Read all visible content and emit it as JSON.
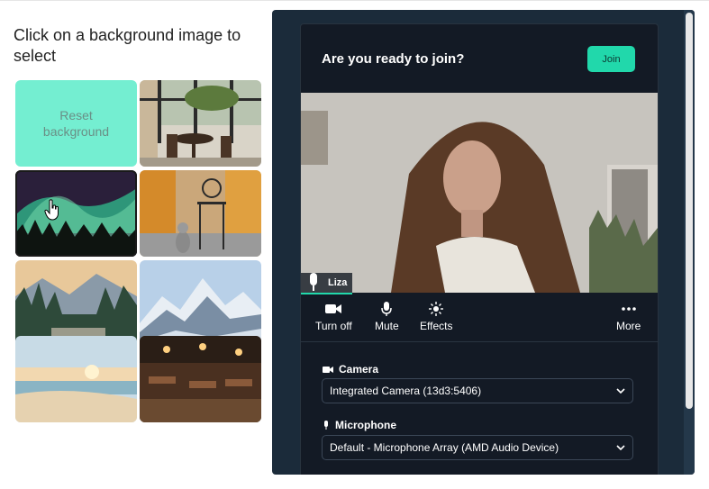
{
  "left_panel": {
    "instruction": "Click on a background image to select",
    "reset_label": "Reset background",
    "backgrounds": [
      {
        "name": "restaurant-terrace"
      },
      {
        "name": "aurora-forest"
      },
      {
        "name": "cafe-table-cat"
      },
      {
        "name": "mountain-forest"
      },
      {
        "name": "snowy-mountains"
      },
      {
        "name": "beach-sunset"
      },
      {
        "name": "restaurant-interior"
      }
    ]
  },
  "join_card": {
    "title": "Are you ready to join?",
    "join_label": "Join",
    "participant_name": "Liza",
    "controls": {
      "turn_off": "Turn off",
      "mute": "Mute",
      "effects": "Effects",
      "more": "More"
    },
    "camera": {
      "label": "Camera",
      "value": "Integrated Camera (13d3:5406)"
    },
    "microphone": {
      "label": "Microphone",
      "value": "Default - Microphone Array (AMD Audio Device)"
    }
  },
  "colors": {
    "accent": "#21d8ab",
    "reset_tile": "#74eed1",
    "panel_bg": "#1b2b3a",
    "card_bg": "#131a25"
  }
}
